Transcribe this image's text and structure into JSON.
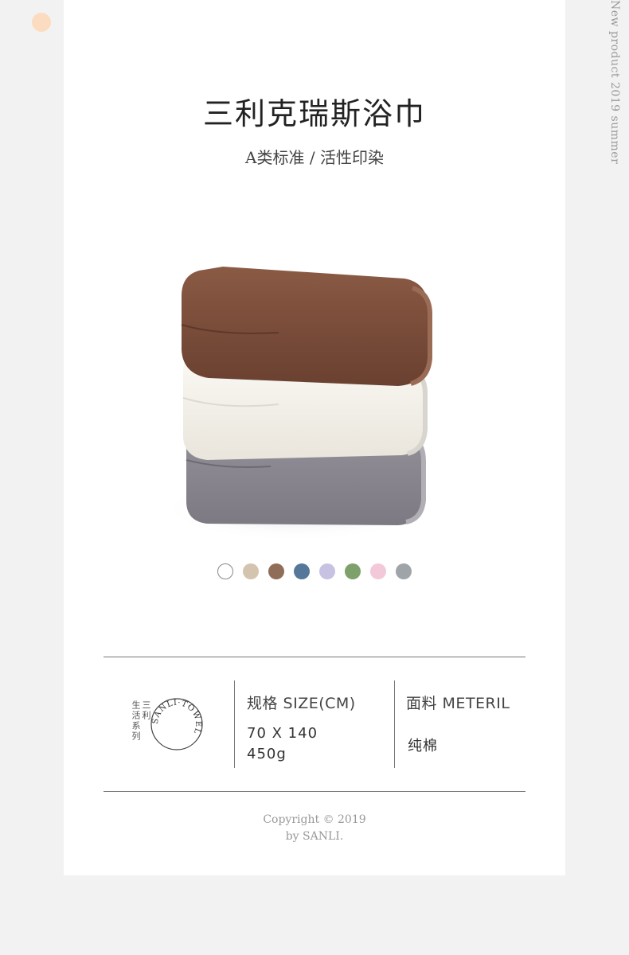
{
  "side_text": "New product 2019 summer",
  "title": "三利克瑞斯浴巾",
  "subtitle": "A类标准 / 活性印染",
  "colors": {
    "accent_dot": "#fcdcc0",
    "towel_brown": "#7a4b37",
    "towel_white": "#f4f1ea",
    "towel_gray": "#8a8690"
  },
  "swatches": [
    "#ffffff",
    "#d4c4af",
    "#8f6d58",
    "#55779a",
    "#c8c2e2",
    "#7ea06a",
    "#f3c9d9",
    "#9ea4a8"
  ],
  "brand": {
    "vertical_line_1": "三利",
    "vertical_line_2": "生活系列",
    "seal_text": "SANLI·TOWEL"
  },
  "spec": {
    "size_label": "规格 SIZE(CM)",
    "size_value": "70 X 140",
    "weight_value": "450g",
    "material_label": "面料 METERIL",
    "material_value": "纯棉"
  },
  "copyright": {
    "line1": "Copyright © 2019",
    "line2": "by SANLI."
  }
}
